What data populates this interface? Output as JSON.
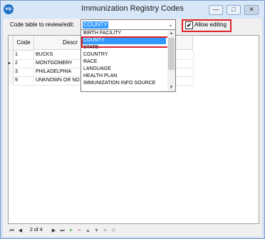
{
  "window": {
    "title": "Immunization Registry Codes",
    "app_icon_text": "eip",
    "controls": {
      "minimize": "—",
      "maximize": "□",
      "close": "✕"
    }
  },
  "toolbar": {
    "code_table_label": "Code table to review/edit:",
    "combo_value": "COUNTY",
    "combo_arrow": "⌄",
    "allow_editing_label": "Allow editing",
    "allow_editing_checked": "✔"
  },
  "grid": {
    "columns": [
      "Code",
      "Descr"
    ],
    "rows": [
      {
        "marker": "",
        "code": "1",
        "description": "BUCKS"
      },
      {
        "marker": "▸",
        "code": "2",
        "description": "MONTGOMERY"
      },
      {
        "marker": "",
        "code": "3",
        "description": "PHILADELPHIA"
      },
      {
        "marker": "",
        "code": "9",
        "description": "UNKNOWN OR NO"
      }
    ]
  },
  "dropdown": {
    "options": [
      "BIRTH FACILITY",
      "COUNTY",
      "STATE",
      "COUNTRY",
      "RACE",
      "LANGUAGE",
      "HEALTH PLAN",
      "IMMUNIZATION INFO SOURCE"
    ],
    "selected": "COUNTY",
    "scroll_up": "▴",
    "scroll_down": "▾"
  },
  "navigator": {
    "position_text": "2 of 4",
    "first": "⏮",
    "prev": "◀",
    "next": "▶",
    "last": "⏭",
    "add": "+",
    "delete": "−",
    "up": "▲",
    "down": "▼",
    "cancel": "✕",
    "refresh": "⟳"
  }
}
